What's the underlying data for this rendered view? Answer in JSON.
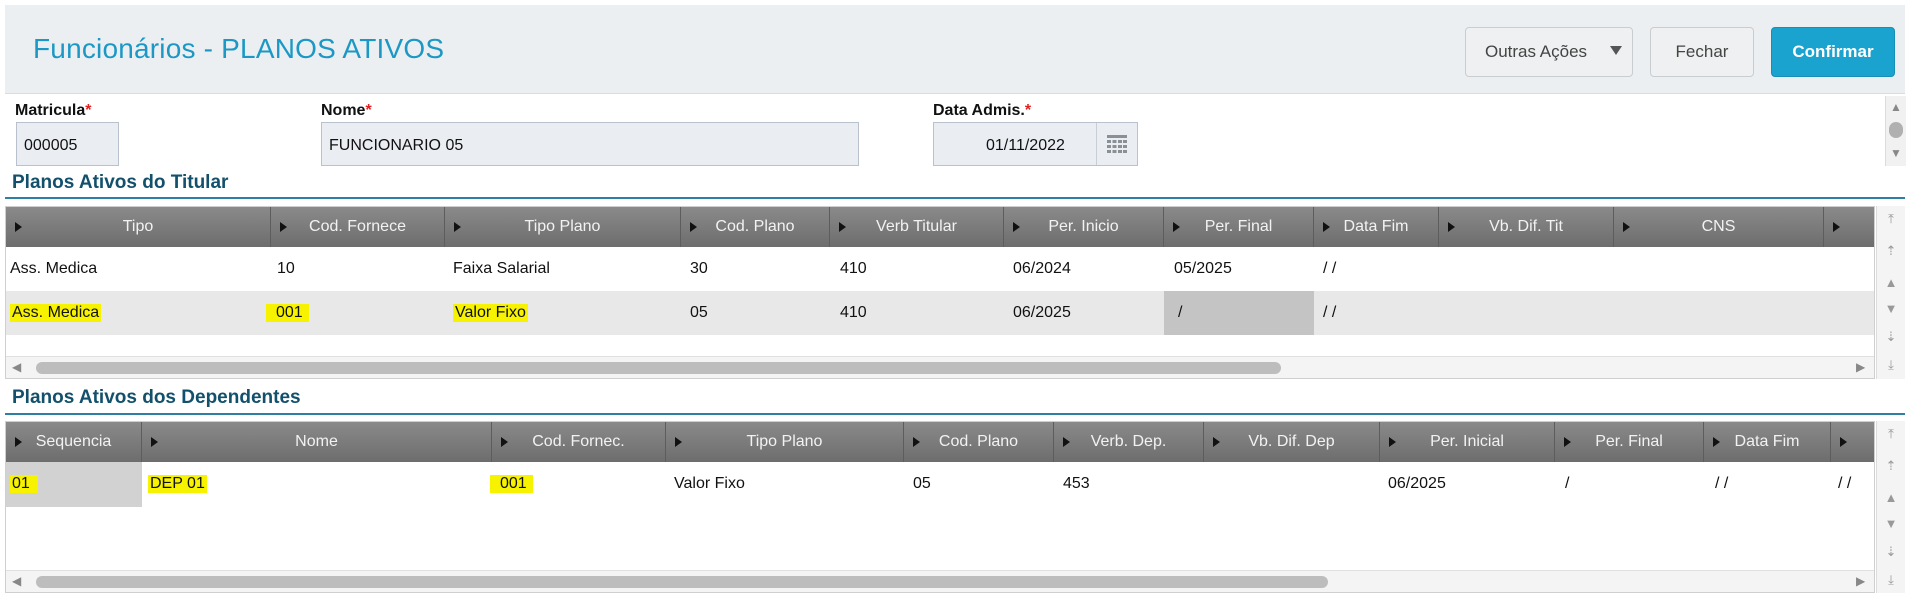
{
  "header": {
    "title": "Funcionários - PLANOS ATIVOS",
    "buttons": {
      "outras": "Outras Ações",
      "fechar": "Fechar",
      "confirmar": "Confirmar"
    }
  },
  "fields": {
    "matricula": {
      "label": "Matricula",
      "required": "*",
      "value": "000005"
    },
    "nome": {
      "label": "Nome",
      "required": "*",
      "value": "FUNCIONARIO 05"
    },
    "data_admis": {
      "label": "Data Admis.",
      "required": "*",
      "value": "01/11/2022"
    }
  },
  "titular": {
    "title": "Planos Ativos do Titular",
    "columns": [
      "Tipo",
      "Cod. Fornece",
      "Tipo Plano",
      "Cod. Plano",
      "Verb Titular",
      "Per. Inicio",
      "Per. Final",
      "Data Fim",
      "Vb. Dif. Tit",
      "CNS"
    ],
    "rows": [
      [
        "Ass. Medica",
        "10",
        "Faixa Salarial",
        "30",
        "410",
        "06/2024",
        "05/2025",
        " /  /",
        "",
        ""
      ],
      [
        "Ass. Medica",
        "001",
        "Valor Fixo",
        "05",
        "410",
        "06/2025",
        "  /",
        " /  /",
        "",
        ""
      ]
    ]
  },
  "dependentes": {
    "title": "Planos Ativos dos Dependentes",
    "columns": [
      "Sequencia",
      "Nome",
      "Cod. Fornec.",
      "Tipo Plano",
      "Cod. Plano",
      "Verb. Dep.",
      "Vb. Dif. Dep",
      "Per. Inicial",
      "Per. Final",
      "Data Fim"
    ],
    "rows": [
      [
        "01",
        "DEP 01",
        "001",
        "Valor Fixo",
        "05",
        "453",
        "",
        "06/2025",
        "  /",
        " /  /",
        " /  /"
      ]
    ]
  },
  "colors": {
    "accent": "#1aa3cf",
    "title": "#1b98c5",
    "section": "#12506c",
    "highlight": "#f6f200"
  },
  "icons": {
    "calendar": "calendar-icon",
    "dropdown": "chevron-down-icon"
  }
}
